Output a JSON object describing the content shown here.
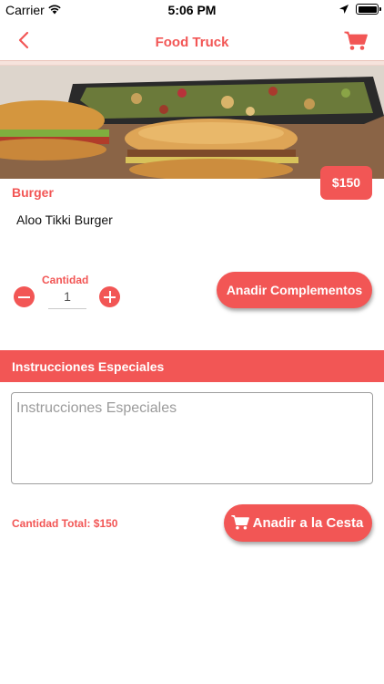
{
  "status_bar": {
    "carrier": "Carrier",
    "time": "5:06 PM"
  },
  "nav": {
    "title": "Food Truck",
    "back_icon": "chevron-left-icon",
    "cart_icon": "cart-icon"
  },
  "product": {
    "category": "Burger",
    "name": "Aloo Tikki Burger",
    "price": "$150"
  },
  "quantity": {
    "label": "Cantidad",
    "value": "1"
  },
  "buttons": {
    "add_complements": "Anadir Complementos",
    "add_to_cart": "Anadir a la Cesta"
  },
  "special_instructions": {
    "title": "Instrucciones Especiales",
    "placeholder": "Instrucciones Especiales"
  },
  "total": "Cantidad Total: $150",
  "colors": {
    "accent": "#f25655",
    "divider": "#f6e3dc"
  }
}
